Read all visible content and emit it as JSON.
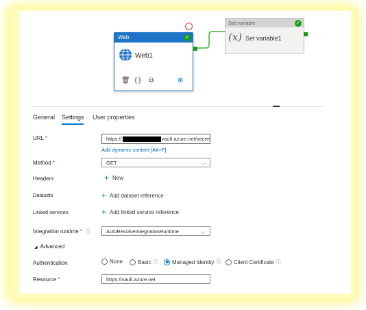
{
  "canvas": {
    "web_activity": {
      "header": "Web",
      "name": "Web1"
    },
    "set_variable_activity": {
      "header": "Set variable",
      "name": "Set variable1",
      "icon_text": "(x)"
    }
  },
  "tabs": [
    {
      "label": "General"
    },
    {
      "label": "Settings"
    },
    {
      "label": "User properties"
    }
  ],
  "settings": {
    "url": {
      "label": "URL",
      "required": "*",
      "value_prefix": "https://",
      "value_suffix": "vault.azure.net/secrets",
      "dynamic_link": "Add dynamic content [Alt+P]"
    },
    "method": {
      "label": "Method",
      "required": "*",
      "value": "GET"
    },
    "headers": {
      "label": "Headers",
      "action": "New"
    },
    "datasets": {
      "label": "Datasets",
      "action": "Add dataset reference"
    },
    "linked_services": {
      "label": "Linked services",
      "action": "Add linked service reference"
    },
    "integration_runtime": {
      "label": "Integration runtime",
      "required": "*",
      "value": "AutoResolveIntegrationRuntime"
    },
    "advanced": {
      "label": "Advanced"
    },
    "authentication": {
      "label": "Authentication",
      "options": [
        "None",
        "Basic",
        "Managed Identity",
        "Client Certificate"
      ],
      "selected": "Managed Identity"
    },
    "resource": {
      "label": "Resource",
      "required": "*",
      "value": "https://vault.azure.net"
    }
  },
  "colors": {
    "accent": "#0078d4",
    "success": "#16a010",
    "required": "#a4262c",
    "highlight_glow": "#fff8a0"
  }
}
